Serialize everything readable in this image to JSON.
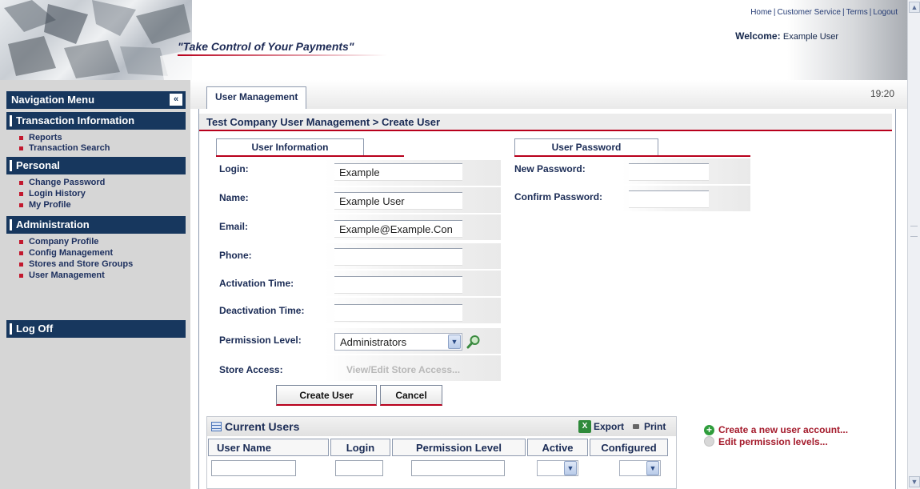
{
  "header": {
    "tagline": "\"Take Control of Your Payments\"",
    "links": [
      "Home",
      "Customer Service",
      "Terms",
      "Logout"
    ],
    "welcome_label": "Welcome:",
    "welcome_user": "Example User"
  },
  "sidebar": {
    "title": "Navigation Menu",
    "collapse_glyph": "«",
    "sections": [
      {
        "label": "Transaction Information",
        "items": [
          "Reports",
          "Transaction Search"
        ]
      },
      {
        "label": "Personal",
        "items": [
          "Change Password",
          "Login History",
          "My Profile"
        ]
      },
      {
        "label": "Administration",
        "items": [
          "Company Profile",
          "Config Management",
          "Stores and Store Groups",
          "User Management"
        ]
      },
      {
        "label": "Log Off",
        "items": []
      }
    ]
  },
  "main": {
    "tab_label": "User Management",
    "clock": "19:20",
    "breadcrumb": "Test Company User Management > Create User",
    "user_info_tab": "User Information",
    "user_password_tab": "User Password",
    "fields": {
      "login": {
        "label": "Login:",
        "value": "Example"
      },
      "name": {
        "label": "Name:",
        "value": "Example User"
      },
      "email": {
        "label": "Email:",
        "value": "Example@Example.Con"
      },
      "phone": {
        "label": "Phone:",
        "value": ""
      },
      "activation_time": {
        "label": "Activation Time:",
        "value": ""
      },
      "deactivation_time": {
        "label": "Deactivation Time:",
        "value": ""
      },
      "permission_level": {
        "label": "Permission Level:",
        "value": "Administrators"
      },
      "store_access": {
        "label": "Store Access:",
        "link": "View/Edit Store Access..."
      },
      "new_password": {
        "label": "New Password:"
      },
      "confirm_password": {
        "label": "Confirm Password:"
      }
    },
    "buttons": {
      "create": "Create User",
      "cancel": "Cancel"
    }
  },
  "current_users": {
    "title": "Current Users",
    "export_label": "Export",
    "print_label": "Print",
    "columns": [
      "User Name",
      "Login",
      "Permission Level",
      "Active",
      "Configured"
    ]
  },
  "side_links": {
    "create_account": "Create a new user account...",
    "edit_permissions": "Edit permission levels..."
  },
  "colors": {
    "nav_blue": "#17375e",
    "accent_red": "#b8001c",
    "link_red": "#a41a2b"
  }
}
